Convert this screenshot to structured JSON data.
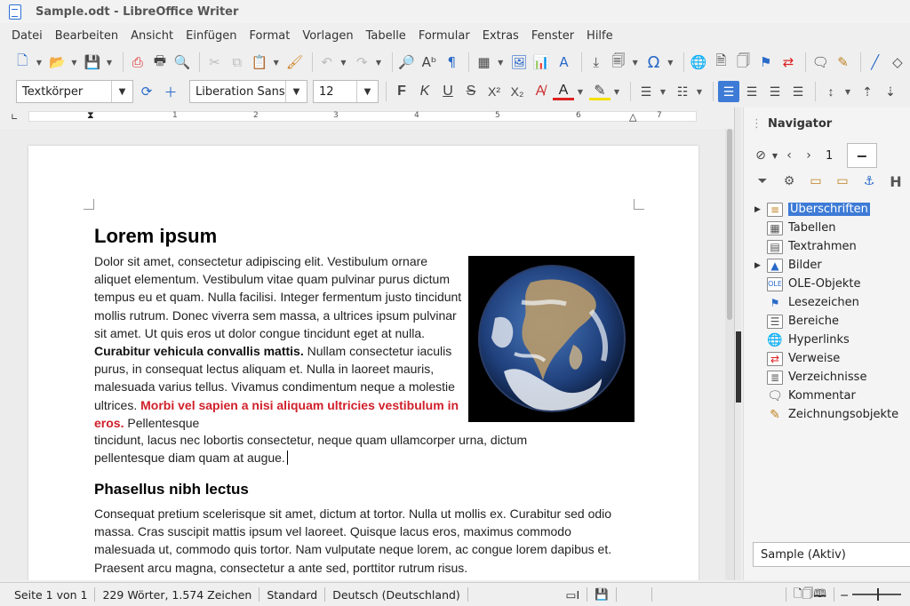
{
  "window": {
    "title": "Sample.odt - LibreOffice Writer"
  },
  "menubar": {
    "items": [
      "Datei",
      "Bearbeiten",
      "Ansicht",
      "Einfügen",
      "Format",
      "Vorlagen",
      "Tabelle",
      "Formular",
      "Extras",
      "Fenster",
      "Hilfe"
    ]
  },
  "formatting": {
    "paragraph_style": "Textkörper",
    "font_name": "Liberation Sans",
    "font_size": "12"
  },
  "ruler": {
    "labels": [
      "1",
      "2",
      "3",
      "4",
      "5",
      "6",
      "7"
    ]
  },
  "document": {
    "heading1": "Lorem ipsum",
    "para1": {
      "normal1": "Dolor sit amet, consectetur adipiscing elit. Vestibulum ornare aliquet elementum. Vestibulum vitae quam pulvinar purus dictum tempus eu et quam. Nulla facilisi. Integer fermentum justo tincidunt mollis rutrum. Donec viverra sem massa, a ultrices ipsum pulvinar sit amet. Ut quis eros ut dolor congue tincidunt eget at nulla.",
      "bold": "Curabitur vehicula convallis mattis.",
      "normal2": "Nullam consectetur iaculis purus, in consequat lectus aliquam et. Nulla in laoreet mauris, malesuada varius tellus. Vivamus condimentum neque a molestie ultrices.",
      "red1": "Morbi vel sapien a",
      "red2": "nisi aliquam ultricies vestibulum in eros.",
      "normal3": "Pellentesque",
      "tail": "tincidunt, lacus nec lobortis consectetur, neque quam ullamcorper urna, dictum pellentesque diam quam at augue."
    },
    "heading2": "Phasellus nibh lectus",
    "para2": "Consequat pretium scelerisque sit amet, dictum at tortor. Nulla ut mollis ex. Curabitur sed odio massa. Cras suscipit mattis ipsum vel laoreet. Quisque lacus eros, maximus commodo malesuada ut, commodo quis tortor. Nam vulputate neque lorem, ac congue lorem dapibus et. Praesent arcu magna, consectetur a ante sed, porttitor rutrum risus."
  },
  "navigator": {
    "title": "Navigator",
    "page_number": "1",
    "items": [
      {
        "label": "Überschriften",
        "icon": "headings-icon",
        "expandable": true,
        "selected": true
      },
      {
        "label": "Tabellen",
        "icon": "table-icon",
        "expandable": false
      },
      {
        "label": "Textrahmen",
        "icon": "frame-icon",
        "expandable": false
      },
      {
        "label": "Bilder",
        "icon": "image-icon",
        "expandable": true
      },
      {
        "label": "OLE-Objekte",
        "icon": "ole-icon",
        "expandable": false
      },
      {
        "label": "Lesezeichen",
        "icon": "bookmark-icon",
        "expandable": false
      },
      {
        "label": "Bereiche",
        "icon": "section-icon",
        "expandable": false
      },
      {
        "label": "Hyperlinks",
        "icon": "globe-icon",
        "expandable": false
      },
      {
        "label": "Verweise",
        "icon": "reference-icon",
        "expandable": false
      },
      {
        "label": "Verzeichnisse",
        "icon": "index-icon",
        "expandable": false
      },
      {
        "label": "Kommentar",
        "icon": "comment-icon",
        "expandable": false
      },
      {
        "label": "Zeichnungsobjekte",
        "icon": "drawing-icon",
        "expandable": false
      }
    ],
    "document_select": "Sample (Aktiv)"
  },
  "statusbar": {
    "page": "Seite 1 von 1",
    "words": "229 Wörter, 1.574 Zeichen",
    "page_style": "Standard",
    "language": "Deutsch (Deutschland)"
  },
  "colors": {
    "accent": "#3d7bd6",
    "red_text": "#d0202a",
    "selection": "#3d7bd6"
  }
}
